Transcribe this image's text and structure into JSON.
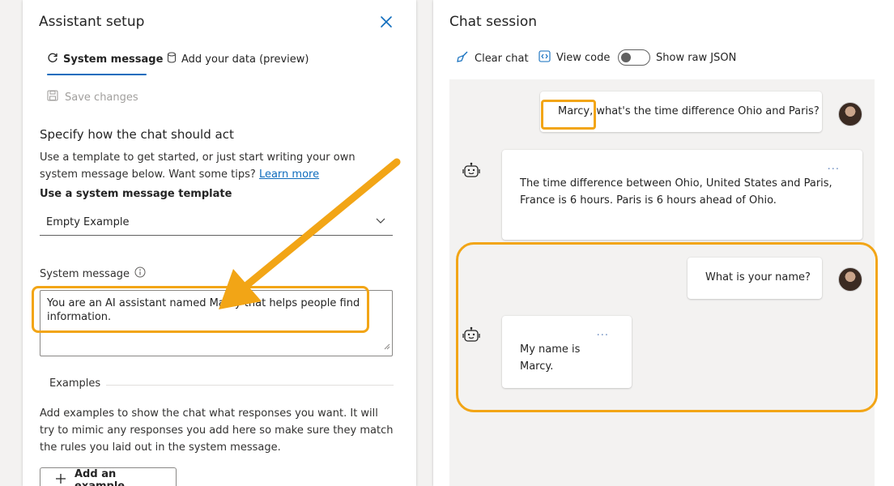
{
  "setup": {
    "title": "Assistant setup",
    "tabs": [
      {
        "label": "System message",
        "icon": "refresh-icon",
        "active": true
      },
      {
        "label": "Add your data (preview)",
        "icon": "cylinder-database-icon",
        "active": false
      }
    ],
    "save_label": "Save changes",
    "section_heading": "Specify how the chat should act",
    "description": "Use a template to get started, or just start writing your own system message below. Want some tips? ",
    "learn_more": "Learn more",
    "template_label": "Use a system message template",
    "template_value": "Empty Example",
    "system_message_label": "System message",
    "system_message_value": "You are an AI assistant named Marcy that helps people find information.",
    "examples_label": "Examples",
    "examples_desc": "Add examples to show the chat what responses you want. It will try to mimic any responses you add here so make sure they match the rules you laid out in the system message.",
    "add_example_label": "Add an example"
  },
  "chat": {
    "title": "Chat session",
    "toolbar": {
      "clear_label": "Clear chat",
      "view_code_label": "View code",
      "raw_json_label": "Show raw JSON",
      "raw_json_on": false
    },
    "messages": [
      {
        "role": "user",
        "text": "Marcy, what's the time difference Ohio and Paris?"
      },
      {
        "role": "assistant",
        "text": "The time difference between Ohio, United States and Paris, France is 6 hours. Paris is 6 hours ahead of Ohio.",
        "menu": "..."
      },
      {
        "role": "user",
        "text": "What is your name?"
      },
      {
        "role": "assistant",
        "text": "My name is Marcy.",
        "menu": "..."
      }
    ]
  },
  "colors": {
    "accent": "#0f6cbd",
    "highlight": "#f2a516",
    "chat_background": "#f3f2f1"
  }
}
